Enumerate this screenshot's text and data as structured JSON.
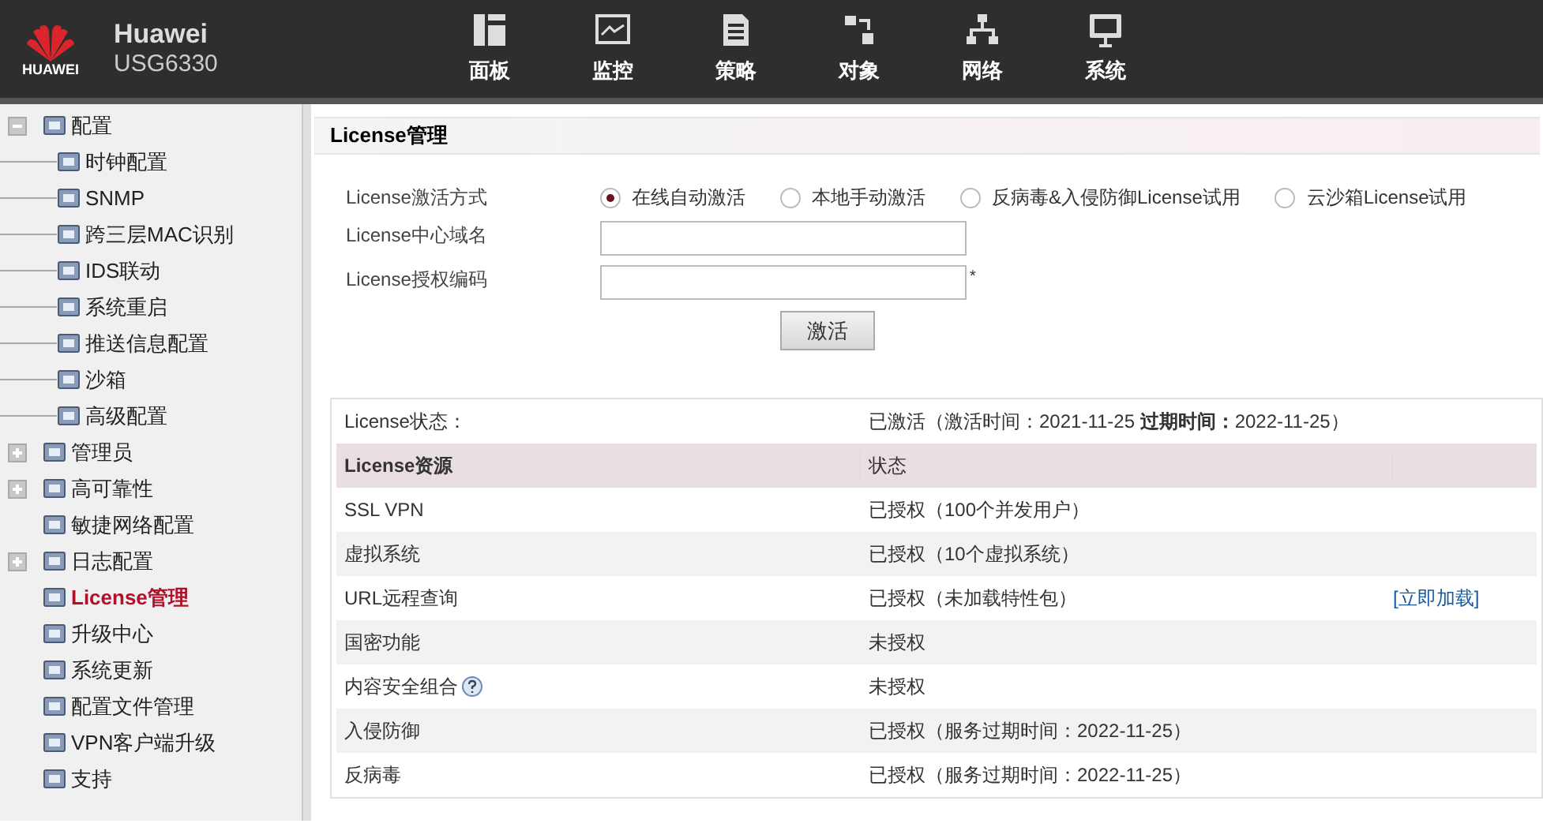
{
  "header": {
    "brand": "HUAWEI",
    "title": "Huawei",
    "model": "USG6330",
    "nav": [
      {
        "label": "面板",
        "kind": "dashboard"
      },
      {
        "label": "监控",
        "kind": "monitor"
      },
      {
        "label": "策略",
        "kind": "policy"
      },
      {
        "label": "对象",
        "kind": "object"
      },
      {
        "label": "网络",
        "kind": "network"
      },
      {
        "label": "系统",
        "kind": "system"
      }
    ]
  },
  "sidebar": {
    "items": [
      {
        "label": "配置",
        "expanded": true,
        "selected": false,
        "children": [
          {
            "label": "时钟配置",
            "selected": false
          },
          {
            "label": "SNMP",
            "selected": false
          },
          {
            "label": "跨三层MAC识别",
            "selected": false
          },
          {
            "label": "IDS联动",
            "selected": false
          },
          {
            "label": "系统重启",
            "selected": false
          },
          {
            "label": "推送信息配置",
            "selected": false
          },
          {
            "label": "沙箱",
            "selected": false
          },
          {
            "label": "高级配置",
            "selected": false
          }
        ]
      },
      {
        "label": "管理员",
        "expanded": false,
        "selected": false
      },
      {
        "label": "高可靠性",
        "expanded": false,
        "selected": false
      },
      {
        "label": "敏捷网络配置",
        "selected": false
      },
      {
        "label": "日志配置",
        "expanded": false,
        "selected": false
      },
      {
        "label": "License管理",
        "selected": true
      },
      {
        "label": "升级中心",
        "selected": false
      },
      {
        "label": "系统更新",
        "selected": false
      },
      {
        "label": "配置文件管理",
        "selected": false
      },
      {
        "label": "VPN客户端升级",
        "selected": false
      },
      {
        "label": "支持",
        "selected": false
      }
    ]
  },
  "panel": {
    "title": "License管理",
    "activation_mode": {
      "label": "License激活方式",
      "options": [
        {
          "label": "在线自动激活",
          "selected": true
        },
        {
          "label": "本地手动激活",
          "selected": false
        },
        {
          "label": "反病毒&入侵防御License试用",
          "selected": false
        },
        {
          "label": "云沙箱License试用",
          "selected": false
        }
      ]
    },
    "fields": [
      {
        "label": "License中心域名"
      },
      {
        "label": "License授权编码",
        "required_mark": "*"
      }
    ],
    "activate_button": "激活",
    "status": {
      "label": "License状态：",
      "value": "已激活（激活时间：2021-11-25 **过期时间：**2022-11-25）"
    },
    "table": {
      "columns": [
        "License资源",
        "状态"
      ],
      "rows": [
        {
          "resource": "SSL VPN",
          "status": "已授权（100个并发用户）"
        },
        {
          "resource": "虚拟系统",
          "status": "已授权（10个虚拟系统）"
        },
        {
          "resource": "URL远程查询",
          "status": "已授权（未加载特性包）",
          "action": "[立即加载]"
        },
        {
          "resource": "国密功能",
          "status": "未授权"
        },
        {
          "resource": "内容安全组合",
          "status": "未授权",
          "help": true
        },
        {
          "resource": "入侵防御",
          "status": "已授权（服务过期时间：2022-11-25）"
        },
        {
          "resource": "反病毒",
          "status": "已授权（服务过期时间：2022-11-25）"
        }
      ]
    }
  }
}
